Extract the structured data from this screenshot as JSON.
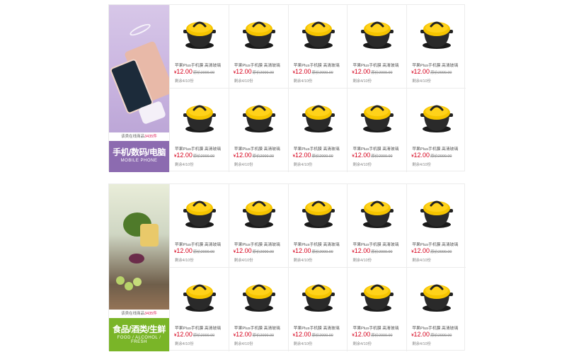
{
  "floors": [
    {
      "online_prefix": "该类在线商品",
      "online_count": "3435件",
      "title_cn": "手机/数码/电脑",
      "title_en": "MOBILE PHONE",
      "products": [
        {
          "name": "苹果Plus手机膜 高清玻璃",
          "currency": "¥",
          "price": "12.00",
          "orig_price": "原价2000.00",
          "remain": "剩余4/10份"
        },
        {
          "name": "苹果Plus手机膜 高清玻璃",
          "currency": "¥",
          "price": "12.00",
          "orig_price": "原价2000.00",
          "remain": "剩余4/10份"
        },
        {
          "name": "苹果Plus手机膜 高清玻璃",
          "currency": "¥",
          "price": "12.00",
          "orig_price": "原价2000.00",
          "remain": "剩余4/10份"
        },
        {
          "name": "苹果Plus手机膜 高清玻璃",
          "currency": "¥",
          "price": "12.00",
          "orig_price": "原价2000.00",
          "remain": "剩余4/10份"
        },
        {
          "name": "苹果Plus手机膜 高清玻璃",
          "currency": "¥",
          "price": "12.00",
          "orig_price": "原价2000.00",
          "remain": "剩余4/10份"
        },
        {
          "name": "苹果Plus手机膜 高清玻璃",
          "currency": "¥",
          "price": "12.00",
          "orig_price": "原价2000.00",
          "remain": "剩余4/10份"
        },
        {
          "name": "苹果Plus手机膜 高清玻璃",
          "currency": "¥",
          "price": "12.00",
          "orig_price": "原价2000.00",
          "remain": "剩余4/10份"
        },
        {
          "name": "苹果Plus手机膜 高清玻璃",
          "currency": "¥",
          "price": "12.00",
          "orig_price": "原价2000.00",
          "remain": "剩余4/10份"
        },
        {
          "name": "苹果Plus手机膜 高清玻璃",
          "currency": "¥",
          "price": "12.00",
          "orig_price": "原价2000.00",
          "remain": "剩余4/10份"
        },
        {
          "name": "苹果Plus手机膜 高清玻璃",
          "currency": "¥",
          "price": "12.00",
          "orig_price": "原价2000.00",
          "remain": "剩余4/10份"
        }
      ]
    },
    {
      "online_prefix": "该类在线商品",
      "online_count": "3435件",
      "title_cn": "食品/酒类/生鲜",
      "title_en": "FOOD / ALCOHOL / FRESH",
      "products": [
        {
          "name": "苹果Plus手机膜 高清玻璃",
          "currency": "¥",
          "price": "12.00",
          "orig_price": "原价2000.00",
          "remain": "剩余4/10份"
        },
        {
          "name": "苹果Plus手机膜 高清玻璃",
          "currency": "¥",
          "price": "12.00",
          "orig_price": "原价2000.00",
          "remain": "剩余4/10份"
        },
        {
          "name": "苹果Plus手机膜 高清玻璃",
          "currency": "¥",
          "price": "12.00",
          "orig_price": "原价2000.00",
          "remain": "剩余4/10份"
        },
        {
          "name": "苹果Plus手机膜 高清玻璃",
          "currency": "¥",
          "price": "12.00",
          "orig_price": "原价2000.00",
          "remain": "剩余4/10份"
        },
        {
          "name": "苹果Plus手机膜 高清玻璃",
          "currency": "¥",
          "price": "12.00",
          "orig_price": "原价2000.00",
          "remain": "剩余4/10份"
        },
        {
          "name": "苹果Plus手机膜 高清玻璃",
          "currency": "¥",
          "price": "12.00",
          "orig_price": "原价2000.00",
          "remain": "剩余4/10份"
        },
        {
          "name": "苹果Plus手机膜 高清玻璃",
          "currency": "¥",
          "price": "12.00",
          "orig_price": "原价2000.00",
          "remain": "剩余4/10份"
        },
        {
          "name": "苹果Plus手机膜 高清玻璃",
          "currency": "¥",
          "price": "12.00",
          "orig_price": "原价2000.00",
          "remain": "剩余4/10份"
        },
        {
          "name": "苹果Plus手机膜 高清玻璃",
          "currency": "¥",
          "price": "12.00",
          "orig_price": "原价2000.00",
          "remain": "剩余4/10份"
        },
        {
          "name": "苹果Plus手机膜 高清玻璃",
          "currency": "¥",
          "price": "12.00",
          "orig_price": "原价2000.00",
          "remain": "剩余4/10份"
        }
      ]
    }
  ],
  "colors": {
    "price": "#d5001b",
    "floor1_accent": "#8c6bb0",
    "floor2_accent": "#7ab528",
    "pot_lid": "#f5c400",
    "pot_body": "#2a2a2a"
  },
  "icons": {
    "product_image": "yellow-lid-casserole-pot"
  }
}
